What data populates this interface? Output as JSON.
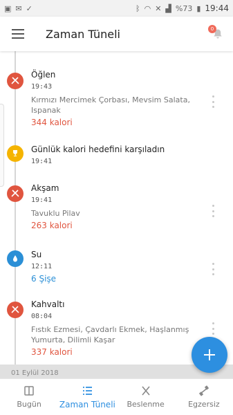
{
  "status_bar": {
    "left_icons": [
      "image-icon",
      "mail-icon",
      "check-icon"
    ],
    "right_icons": [
      "bluetooth-icon",
      "wifi-icon",
      "mute-icon",
      "signal-icon",
      "battery-icon"
    ],
    "battery_percent": "%73",
    "time": "19:44"
  },
  "app_bar": {
    "title": "Zaman Tüneli",
    "notification_count": "0"
  },
  "timeline": {
    "entries": [
      {
        "type": "meal",
        "icon": "utensils-icon",
        "color": "#e0553f",
        "title": "Öğlen",
        "time": "19:43",
        "desc": "Kırmızı Mercimek Çorbası, Mevsim Salata, Ispanak",
        "value": "344 kalori"
      },
      {
        "type": "goal",
        "icon": "trophy-icon",
        "color": "#f5b400",
        "title": "Günlük kalori hedefini karşıladın",
        "time": "19:41"
      },
      {
        "type": "meal",
        "icon": "utensils-icon",
        "color": "#e0553f",
        "title": "Akşam",
        "time": "19:41",
        "desc": "Tavuklu Pilav",
        "value": "263 kalori"
      },
      {
        "type": "water",
        "icon": "water-drop-icon",
        "color": "#2b8fd6",
        "title": "Su",
        "time": "12:11",
        "value": "6 Şişe"
      },
      {
        "type": "meal",
        "icon": "utensils-icon",
        "color": "#e0553f",
        "title": "Kahvaltı",
        "time": "08:04",
        "desc": "Fıstık Ezmesi, Çavdarlı Ekmek, Haşlanmış Yumurta, Dilimli Kaşar",
        "value": "337 kalori"
      }
    ],
    "next_date": "01 Eylül 2018"
  },
  "bottom_nav": {
    "items": [
      {
        "label": "Bugün",
        "icon": "calendar-icon",
        "active": false
      },
      {
        "label": "Zaman Tüneli",
        "icon": "list-icon",
        "active": true
      },
      {
        "label": "Beslenme",
        "icon": "utensils-icon",
        "active": false
      },
      {
        "label": "Egzersiz",
        "icon": "dumbbell-icon",
        "active": false
      }
    ]
  },
  "colors": {
    "accent": "#2d8fe0",
    "meal": "#e0553f",
    "goal": "#f5b400",
    "water": "#2b8fd6"
  }
}
